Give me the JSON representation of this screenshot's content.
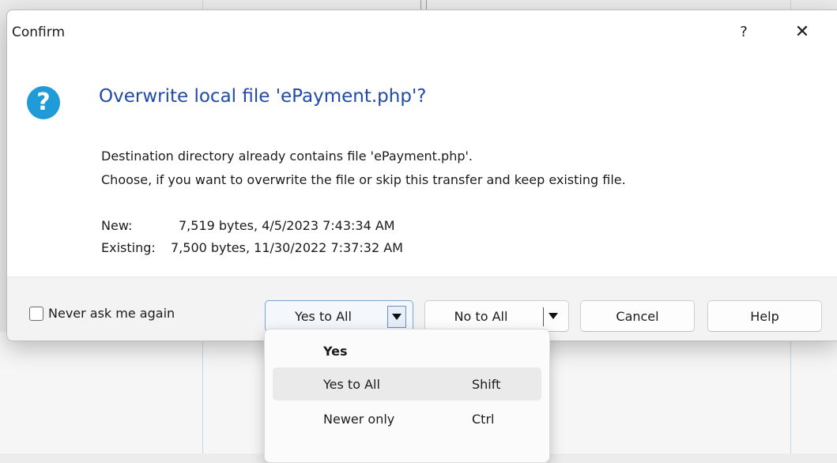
{
  "dialog": {
    "title": "Confirm",
    "help_glyph": "?",
    "close_glyph": "✕",
    "icon_glyph": "?",
    "heading": "Overwrite local file 'ePayment.php'?",
    "message_line1": "Destination directory already contains file 'ePayment.php'.",
    "message_line2": "Choose, if you want to overwrite the file or skip this transfer and keep existing file.",
    "new_label": "New:",
    "new_value": "7,519 bytes, 4/5/2023 7:43:34 AM",
    "existing_label": "Existing:",
    "existing_value": "7,500 bytes, 11/30/2022 7:37:32 AM"
  },
  "footer": {
    "never_ask_label": "Never ask me again",
    "never_ask_checked": false,
    "yes_to_all_label": "Yes to All",
    "no_to_all_label": "No to All",
    "cancel_label": "Cancel",
    "help_label": "Help"
  },
  "menu": {
    "items": [
      {
        "label": "Yes",
        "shortcut": ""
      },
      {
        "label": "Yes to All",
        "shortcut": "Shift"
      },
      {
        "label": "Newer only",
        "shortcut": "Ctrl"
      }
    ]
  },
  "colors": {
    "heading": "#1f4aa8",
    "icon": "#1f9bd7",
    "highlight": "#eaeaea"
  }
}
